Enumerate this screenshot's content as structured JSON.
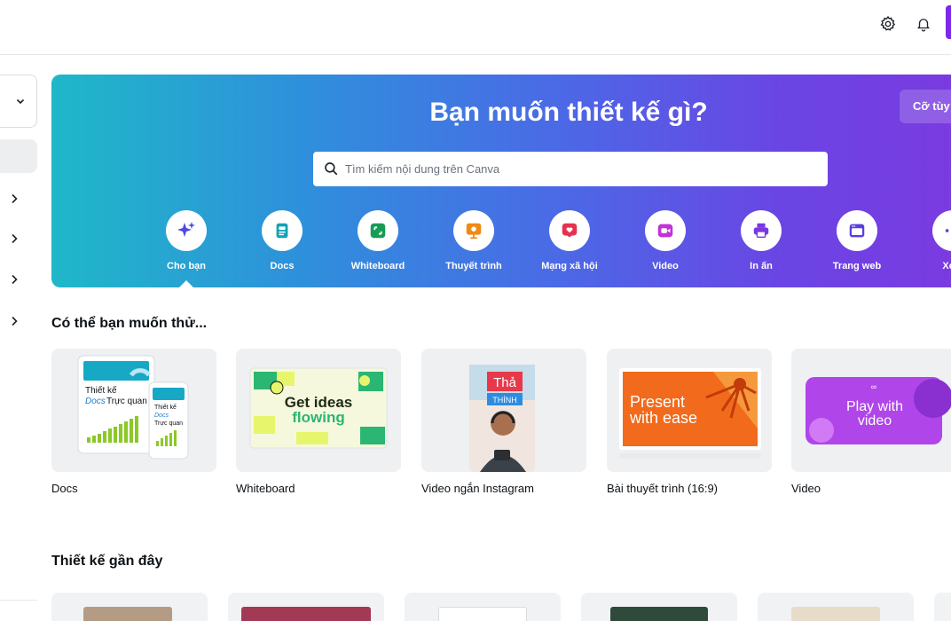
{
  "header": {
    "settings_icon": "gear-icon",
    "notifications_icon": "bell-icon"
  },
  "sidebar": {
    "dropdown_icon": "chevron-down-icon",
    "expand_icon": "chevron-right-icon"
  },
  "hero": {
    "title": "Bạn muốn thiết kế gì?",
    "custom_size_label": "Cỡ tùy",
    "search_placeholder": "Tìm kiếm nội dung trên Canva",
    "categories": [
      {
        "label": "Cho bạn",
        "icon": "sparkle-icon",
        "color": "#4d49e0"
      },
      {
        "label": "Docs",
        "icon": "docs-icon",
        "color": "#13a3b5"
      },
      {
        "label": "Whiteboard",
        "icon": "whiteboard-icon",
        "color": "#169c55"
      },
      {
        "label": "Thuyết trình",
        "icon": "presentation-icon",
        "color": "#f08a17"
      },
      {
        "label": "Mạng xã hội",
        "icon": "heart-icon",
        "color": "#e5334d"
      },
      {
        "label": "Video",
        "icon": "video-icon",
        "color": "#c233d6"
      },
      {
        "label": "In ấn",
        "icon": "printer-icon",
        "color": "#7a38e0"
      },
      {
        "label": "Trang web",
        "icon": "website-icon",
        "color": "#5b3ee0"
      },
      {
        "label": "Xem",
        "icon": "more-icon",
        "color": "#6a3ce0"
      }
    ]
  },
  "suggestions": {
    "title": "Có thể bạn muốn thử...",
    "items": [
      {
        "label": "Docs",
        "thumb_line1": "Thiết kế",
        "thumb_line2": "Docs",
        "thumb_line3": "Trực quan",
        "thumb_small1": "Thiết kế",
        "thumb_small2": "Docs",
        "thumb_small3": "Trực quan"
      },
      {
        "label": "Whiteboard",
        "thumb_line1": "Get ideas",
        "thumb_line2": "flowing"
      },
      {
        "label": "Video ngắn Instagram",
        "thumb_line1": "Thả",
        "thumb_line2": "THÍNH"
      },
      {
        "label": "Bài thuyết trình (16:9)",
        "thumb_line1": "Present",
        "thumb_line2": "with ease"
      },
      {
        "label": "Video",
        "thumb_line1": "Play with",
        "thumb_line2": "video"
      }
    ]
  },
  "recent": {
    "title": "Thiết kế gần đây"
  }
}
